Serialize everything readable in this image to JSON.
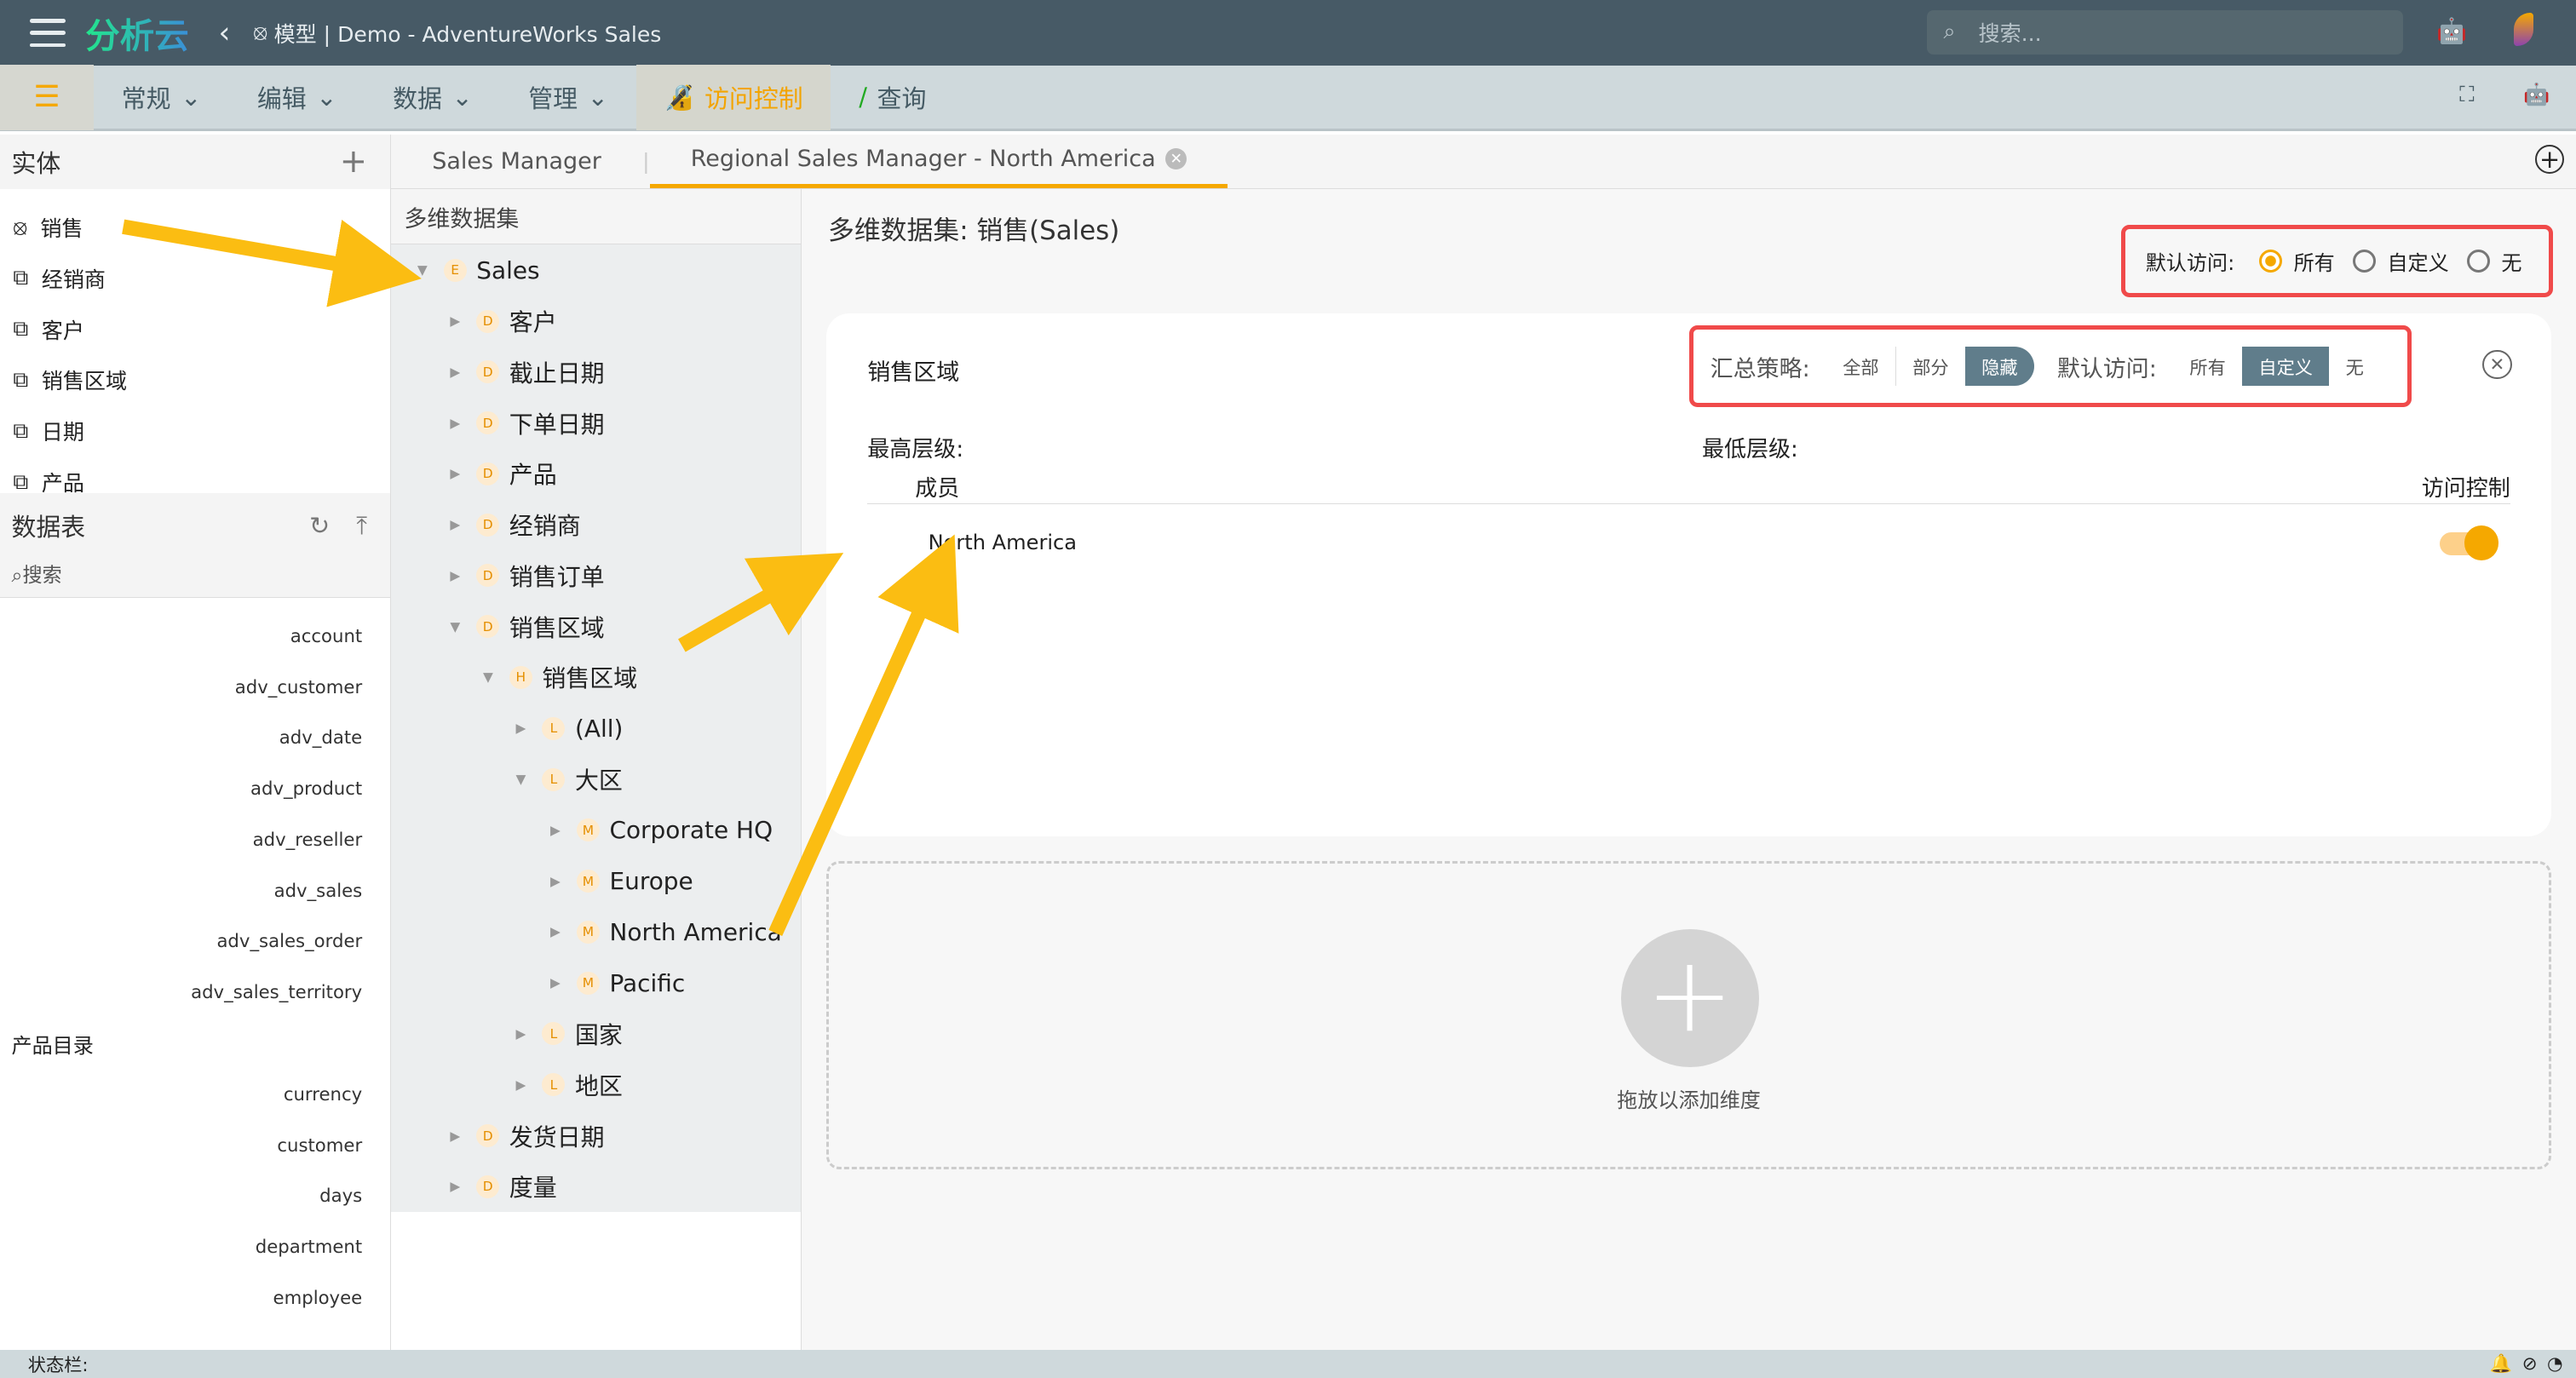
{
  "topbar": {
    "logo": "分析云",
    "title": "模型 | Demo - AdventureWorks Sales",
    "search_placeholder": "搜索..."
  },
  "toolbar": {
    "items": [
      "常规",
      "编辑",
      "数据",
      "管理"
    ],
    "access": "访问控制",
    "query": "查询"
  },
  "entities": {
    "title": "实体",
    "items": [
      "销售",
      "经销商",
      "客户",
      "销售区域",
      "日期",
      "产品"
    ]
  },
  "tables": {
    "title": "数据表",
    "search_placeholder": "搜索",
    "items": [
      "account",
      "adv_customer",
      "adv_date",
      "adv_product",
      "adv_reseller",
      "adv_sales",
      "adv_sales_order",
      "adv_sales_territory"
    ],
    "group": "产品目录",
    "group_items": [
      "currency",
      "customer",
      "days",
      "department",
      "employee"
    ]
  },
  "tabs": [
    "Sales Manager",
    "Regional Sales Manager - North America"
  ],
  "tree": {
    "title": "多维数据集",
    "nodes": [
      {
        "badge": "E",
        "label": "Sales",
        "level": 0,
        "caret": "▼"
      },
      {
        "badge": "D",
        "label": "客户",
        "level": 1,
        "caret": "▶"
      },
      {
        "badge": "D",
        "label": "截止日期",
        "level": 1,
        "caret": "▶"
      },
      {
        "badge": "D",
        "label": "下单日期",
        "level": 1,
        "caret": "▶"
      },
      {
        "badge": "D",
        "label": "产品",
        "level": 1,
        "caret": "▶"
      },
      {
        "badge": "D",
        "label": "经销商",
        "level": 1,
        "caret": "▶"
      },
      {
        "badge": "D",
        "label": "销售订单",
        "level": 1,
        "caret": "▶"
      },
      {
        "badge": "D",
        "label": "销售区域",
        "level": 1,
        "caret": "▼"
      },
      {
        "badge": "H",
        "label": "销售区域",
        "level": 2,
        "caret": "▼"
      },
      {
        "badge": "L",
        "label": "(All)",
        "level": 3,
        "caret": "▶"
      },
      {
        "badge": "L",
        "label": "大区",
        "level": 3,
        "caret": "▼"
      },
      {
        "badge": "M",
        "label": "Corporate HQ",
        "level": 4,
        "caret": "▶"
      },
      {
        "badge": "M",
        "label": "Europe",
        "level": 4,
        "caret": "▶"
      },
      {
        "badge": "M",
        "label": "North America",
        "level": 4,
        "caret": "▶"
      },
      {
        "badge": "M",
        "label": "Pacific",
        "level": 4,
        "caret": "▶"
      },
      {
        "badge": "L",
        "label": "国家",
        "level": 3,
        "caret": "▶"
      },
      {
        "badge": "L",
        "label": "地区",
        "level": 3,
        "caret": "▶"
      },
      {
        "badge": "D",
        "label": "发货日期",
        "level": 1,
        "caret": "▶"
      },
      {
        "badge": "D",
        "label": "度量",
        "level": 1,
        "caret": "▶"
      }
    ]
  },
  "main": {
    "cube_label": "多维数据集:",
    "cube_name": "销售(Sales)",
    "default_access": "默认访问:",
    "access_opts": [
      "所有",
      "自定义",
      "无"
    ],
    "access_selected": "所有",
    "card": {
      "title": "销售区域",
      "agg_label": "汇总策略:",
      "agg_opts": [
        "全部",
        "部分",
        "隐藏"
      ],
      "agg_selected": "隐藏",
      "access_label": "默认访问:",
      "access_opts": [
        "所有",
        "自定义",
        "无"
      ],
      "access_selected": "自定义",
      "top_level": "最高层级:",
      "bottom_level": "最低层级:",
      "col_member": "成员",
      "col_access": "访问控制",
      "member": "North America",
      "member_on": true
    },
    "drop_text": "拖放以添加维度"
  },
  "status": {
    "label": "状态栏:"
  },
  "colors": {
    "accent": "#f5a800",
    "topbar": "#475a66",
    "highlight": "#f04a4a"
  }
}
